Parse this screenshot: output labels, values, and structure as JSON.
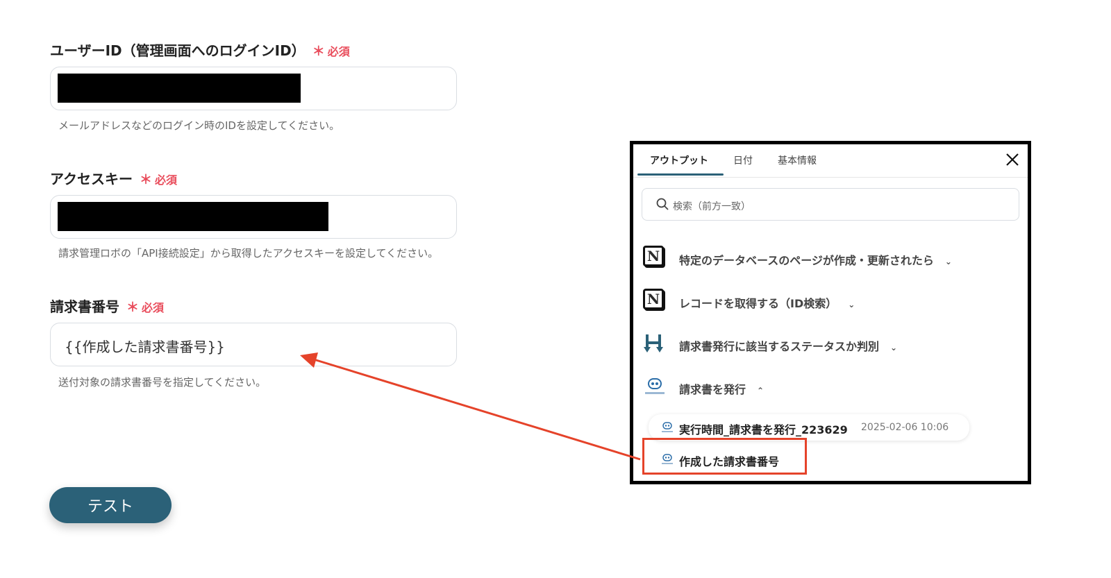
{
  "form": {
    "user_id": {
      "label": "ユーザーID（管理画面へのログインID）",
      "required_mark": "＊",
      "required_text": "必須",
      "help": "メールアドレスなどのログイン時のIDを設定してください。"
    },
    "access_key": {
      "label": "アクセスキー",
      "required_mark": "＊",
      "required_text": "必須",
      "help": "請求管理ロボの「API接続設定」から取得したアクセスキーを設定してください。"
    },
    "invoice_number": {
      "label": "請求書番号",
      "required_mark": "＊",
      "required_text": "必須",
      "value": "{{作成した請求書番号}}",
      "help": "送付対象の請求書番号を指定してください。"
    },
    "test_button": "テスト"
  },
  "panel": {
    "tabs": [
      {
        "label": "アウトプット",
        "active": true
      },
      {
        "label": "日付",
        "active": false
      },
      {
        "label": "基本情報",
        "active": false
      }
    ],
    "search_placeholder": "検索（前方一致）",
    "steps": [
      {
        "icon": "notion-icon",
        "label": "特定のデータベースのページが作成・更新されたら",
        "expanded": false
      },
      {
        "icon": "notion-icon",
        "label": "レコードを取得する（ID検索）",
        "expanded": false
      },
      {
        "icon": "branch-icon",
        "label": "請求書発行に該当するステータスか判別",
        "expanded": false
      },
      {
        "icon": "robot-icon",
        "label": "請求書を発行",
        "expanded": true
      }
    ],
    "outputs": [
      {
        "label": "実行時間_請求書を発行_223629",
        "meta": "2025-02-06 10:06"
      },
      {
        "label": "作成した請求書番号",
        "meta": ""
      }
    ]
  },
  "colors": {
    "accent": "#2b6178",
    "required": "#e94d5c",
    "annotation": "#e5432a"
  }
}
